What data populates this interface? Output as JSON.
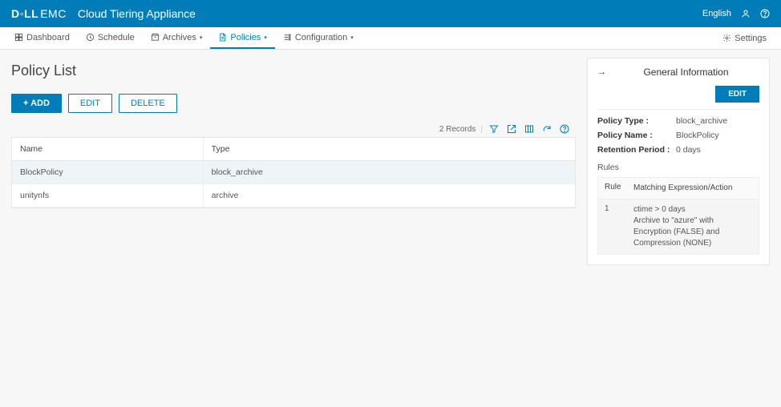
{
  "header": {
    "brand_logo": "D E LLEMC",
    "product": "Cloud Tiering Appliance",
    "language": "English"
  },
  "nav": {
    "items": [
      {
        "label": "Dashboard",
        "dropdown": false
      },
      {
        "label": "Schedule",
        "dropdown": false
      },
      {
        "label": "Archives",
        "dropdown": true
      },
      {
        "label": "Policies",
        "dropdown": true,
        "active": true
      },
      {
        "label": "Configuration",
        "dropdown": true
      }
    ],
    "settings": "Settings"
  },
  "page": {
    "title": "Policy List",
    "add": "+ ADD",
    "edit": "EDIT",
    "delete": "DELETE",
    "records_label": "2 Records",
    "columns": {
      "name": "Name",
      "type": "Type"
    },
    "rows": [
      {
        "name": "BlockPolicy",
        "type": "block_archive",
        "selected": true
      },
      {
        "name": "unitynfs",
        "type": "archive",
        "selected": false
      }
    ]
  },
  "panel": {
    "title": "General Information",
    "edit": "EDIT",
    "fields": {
      "policy_type": {
        "label": "Policy Type :",
        "value": "block_archive"
      },
      "policy_name": {
        "label": "Policy Name :",
        "value": "BlockPolicy"
      },
      "retention": {
        "label": "Retention Period :",
        "value": "0 days"
      }
    },
    "rules_title": "Rules",
    "rules_columns": {
      "rule": "Rule",
      "match": "Matching Expression/Action"
    },
    "rules": [
      {
        "rule": "1",
        "text": "ctime > 0 days\nArchive to \"azure\" with Encryption (FALSE) and Compression (NONE)"
      }
    ]
  }
}
